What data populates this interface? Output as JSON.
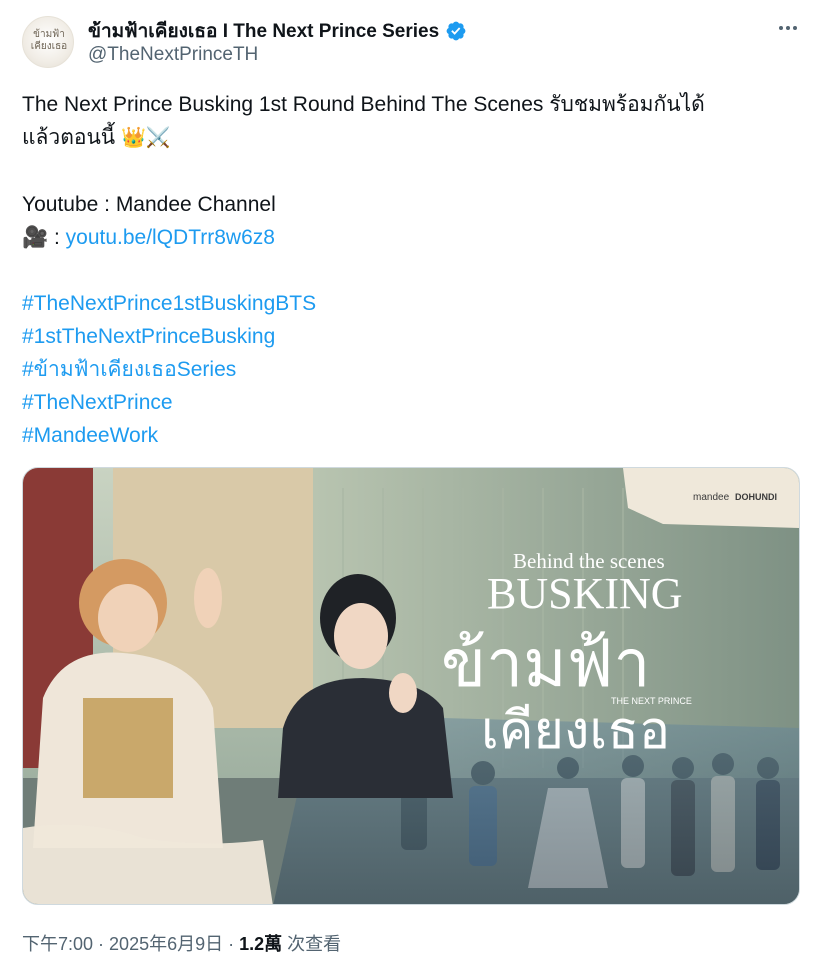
{
  "author": {
    "display_name": "ข้ามฟ้าเคียงเธอ I The Next Prince Series",
    "handle": "@TheNextPrinceTH",
    "avatar_logo_text": "ข้ามฟ้า เคียงเธอ",
    "verified_icon": "verified-badge-icon",
    "verified_color": "#1d9bf0"
  },
  "tweet": {
    "line1": "The Next Prince Busking 1st Round Behind The Scenes รับชมพร้อมกันได้",
    "line2": "แล้วตอนนี้",
    "line2_emoji": "👑⚔️",
    "youtube_label": "Youtube : Mandee Channel",
    "link_prefix": "🎥 : ",
    "link_text": "youtu.be/lQDTrr8w6z8",
    "hashtags": [
      "#TheNextPrince1stBuskingBTS",
      "#1stTheNextPrinceBusking",
      "#ข้ามฟ้าเคียงเธอSeries",
      "#TheNextPrince",
      "#MandeeWork"
    ]
  },
  "media": {
    "subtitle": "Behind the scenes",
    "title": "BUSKING",
    "thai_line1": "ข้ามฟ้า",
    "thai_line2": "เคียงเธอ",
    "series_tag": "THE NEXT PRINCE",
    "brand_left": "mandee",
    "brand_right": "DOHUNDI"
  },
  "footer": {
    "time": "下午7:00",
    "date": "2025年6月9日",
    "views_count": "1.2萬",
    "views_label": "次查看"
  },
  "colors": {
    "link": "#1d9bf0",
    "secondary_text": "#536471",
    "primary_text": "#0f1419"
  }
}
